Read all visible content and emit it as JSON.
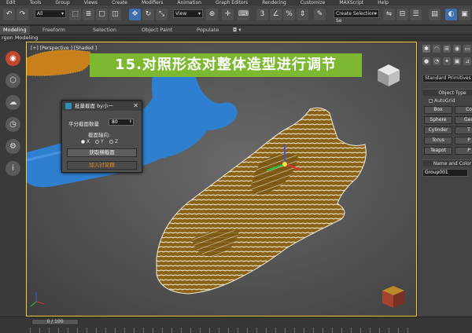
{
  "menu": [
    "Edit",
    "Tools",
    "Group",
    "Views",
    "Create",
    "Modifiers",
    "Animation",
    "Graph Editors",
    "Rendering",
    "Customize",
    "MAXScript",
    "Help"
  ],
  "toolbar": {
    "filter_select": "All",
    "view_select": "View",
    "selection_set": "Create Selection Se"
  },
  "ribbon": {
    "tabs": [
      "Modeling",
      "Freeform",
      "Selection",
      "Object Paint",
      "Populate"
    ],
    "sub_label": "rgon Modeling"
  },
  "viewport": {
    "label": "[+] [Perspective ] [Shaded ]",
    "banner": "15.对照形态对整体造型进行调节"
  },
  "dialog": {
    "title": "批量截面 by小一",
    "count_label": "平分截面数量",
    "count_value": "80",
    "axis_label": "截面轴向:",
    "axes": [
      "X",
      "Y",
      "Z"
    ],
    "selected_axis": "X",
    "get_button": "获取横截面",
    "join_button": "加入讨论群"
  },
  "command_panel": {
    "category": "Standard Primitives",
    "object_type_header": "Object Type",
    "autogrid_label": "AutoGrid",
    "buttons": [
      [
        "Box",
        "Co"
      ],
      [
        "Sphere",
        "Geo"
      ],
      [
        "Cylinder",
        "T"
      ],
      [
        "Torus",
        "P"
      ],
      [
        "Teapot",
        "P"
      ]
    ],
    "name_color_header": "Name and Color",
    "object_name": "Group001"
  },
  "timeline": {
    "frame_readout": "0 / 100"
  },
  "colors": {
    "banner_bg": "#7cb830",
    "wire_stroke": "#f2ecd8",
    "fish_fill": "#8a6318",
    "blue_object": "#2f7fd0",
    "join_text": "#f28c1a"
  }
}
